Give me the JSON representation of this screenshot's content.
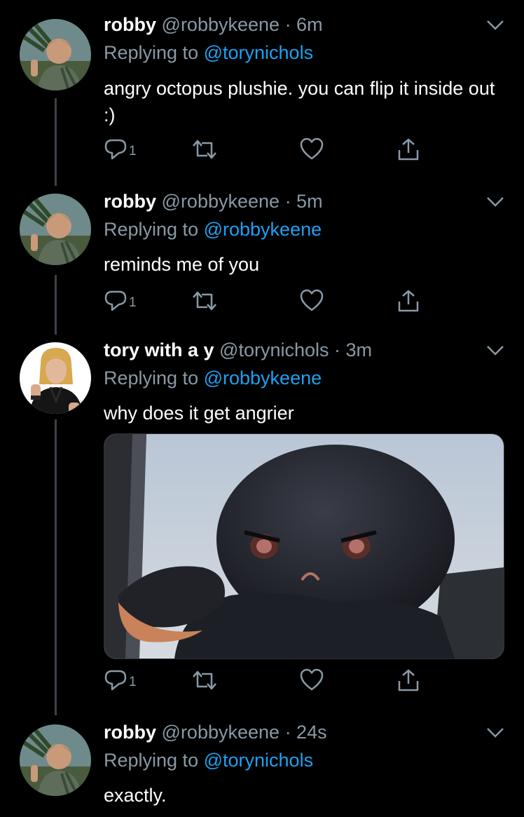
{
  "colors": {
    "accent": "#1da1f2",
    "muted": "#8899a6",
    "background": "#000000",
    "thread_line": "#3d4148"
  },
  "tweets": [
    {
      "name": "robby",
      "handle": "@robbykeene",
      "time": "· 6m",
      "replying_prefix": "Replying to",
      "replying_to": "@torynichols",
      "text": "angry octopus plushie. you can flip it inside out :)",
      "reply_count": "1"
    },
    {
      "name": "robby",
      "handle": "@robbykeene",
      "time": "· 5m",
      "replying_prefix": "Replying to",
      "replying_to": "@robbykeene",
      "text": "reminds me of you",
      "reply_count": "1"
    },
    {
      "name": "tory with a y",
      "handle": "@torynichols",
      "time": "· 3m",
      "replying_prefix": "Replying to",
      "replying_to": "@robbykeene",
      "text": "why does it get angrier",
      "reply_count": "1",
      "media": "photo of a black angry octopus plushie by a car window"
    },
    {
      "name": "robby",
      "handle": "@robbykeene",
      "time": "· 24s",
      "replying_prefix": "Replying to",
      "replying_to": "@torynichols",
      "text": "exactly."
    }
  ],
  "icons": {
    "reply": "reply-icon",
    "retweet": "retweet-icon",
    "like": "heart-icon",
    "share": "share-icon",
    "more": "chevron-down-icon"
  }
}
